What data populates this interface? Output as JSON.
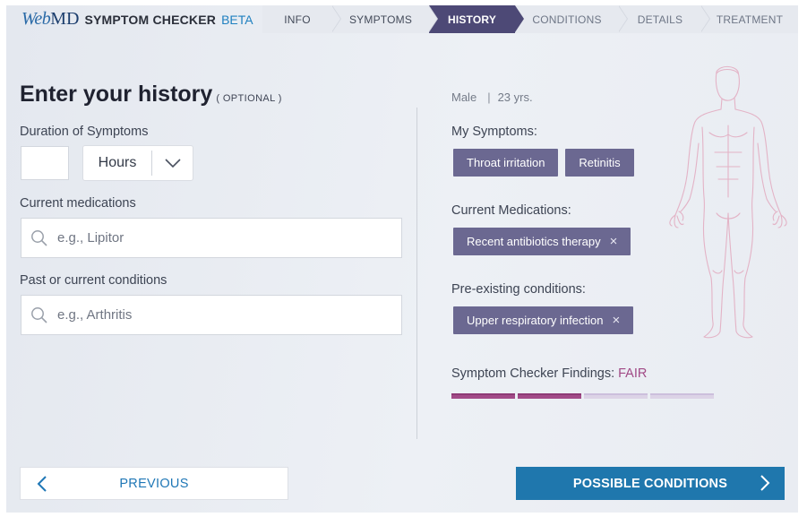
{
  "brand": {
    "logo_web": "Web",
    "logo_md": "MD",
    "title": "SYMPTOM CHECKER",
    "beta": "BETA"
  },
  "steps": [
    {
      "label": "INFO",
      "state": "done"
    },
    {
      "label": "SYMPTOMS",
      "state": "done"
    },
    {
      "label": "HISTORY",
      "state": "active"
    },
    {
      "label": "CONDITIONS",
      "state": "todo"
    },
    {
      "label": "DETAILS",
      "state": "todo"
    },
    {
      "label": "TREATMENT",
      "state": "todo"
    }
  ],
  "history": {
    "title": "Enter your history",
    "optional": "( OPTIONAL )",
    "duration_label": "Duration of Symptoms",
    "duration_value": "",
    "duration_unit": "Hours",
    "medications_label": "Current medications",
    "medications_placeholder": "e.g., Lipitor",
    "conditions_label": "Past or current conditions",
    "conditions_placeholder": "e.g., Arthritis"
  },
  "summary": {
    "sex": "Male",
    "age": "23 yrs.",
    "symptoms_label": "My Symptoms:",
    "symptoms": [
      "Throat irritation",
      "Retinitis"
    ],
    "medications_label": "Current Medications:",
    "medications": [
      "Recent antibiotics therapy"
    ],
    "conditions_label": "Pre-existing conditions:",
    "conditions": [
      "Upper respiratory infection"
    ],
    "findings_label": "Symptom Checker Findings:",
    "findings_value": "FAIR",
    "findings_level": 2,
    "findings_total": 4,
    "remove_glyph": "×"
  },
  "nav": {
    "previous": "PREVIOUS",
    "next": "POSSIBLE CONDITIONS"
  },
  "colors": {
    "accent_blue": "#1f77ad",
    "chip": "#6b6891",
    "step_active": "#4d4976",
    "findings": "#a24b88"
  },
  "icons": {
    "search": "search-icon",
    "dropdown": "chevron-down-icon",
    "remove": "close-icon",
    "prev": "chevron-left-icon",
    "next": "chevron-right-icon"
  }
}
